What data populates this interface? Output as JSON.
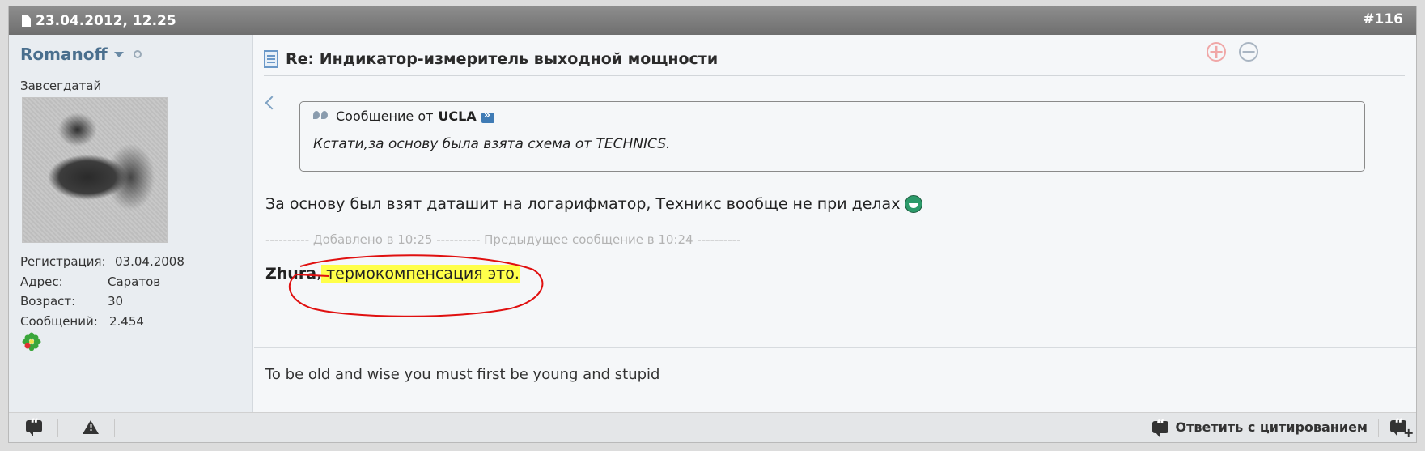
{
  "header": {
    "date": "23.04.2012, 12.25",
    "post_number": "#116"
  },
  "user": {
    "name": "Romanoff",
    "title": "Завсегдатай",
    "stats": [
      {
        "label": "Регистрация:",
        "value": "03.04.2008"
      },
      {
        "label": "Адрес:",
        "value": "Саратов"
      },
      {
        "label": "Возраст:",
        "value": "30"
      },
      {
        "label": "Сообщений:",
        "value": "2.454"
      }
    ]
  },
  "post": {
    "title": "Re: Индикатор-измеритель выходной мощности",
    "rep_plus": "+",
    "rep_minus": "−",
    "quote": {
      "prefix": "Сообщение от",
      "author": "UCLA",
      "text": "Кстати,за основу была взята схема от TECHNICS."
    },
    "message1": "За основу был взят даташит на логарифматор, Техникс вообще не при делах",
    "added_line": "---------- Добавлено в 10:25 ---------- Предыдущее сообщение в 10:24 ----------",
    "message2": {
      "nick": "Zhura",
      "sep": ",",
      "text": " термокомпенсация это."
    },
    "signature": "To be old and wise you must first be young and stupid"
  },
  "footer": {
    "reply_with_quote": "Ответить с цитированием"
  },
  "colors": {
    "header_bg": "#7e7e7e",
    "username": "#4a6f8e",
    "highlight": "#ffff4a",
    "annotation": "#e01010"
  }
}
